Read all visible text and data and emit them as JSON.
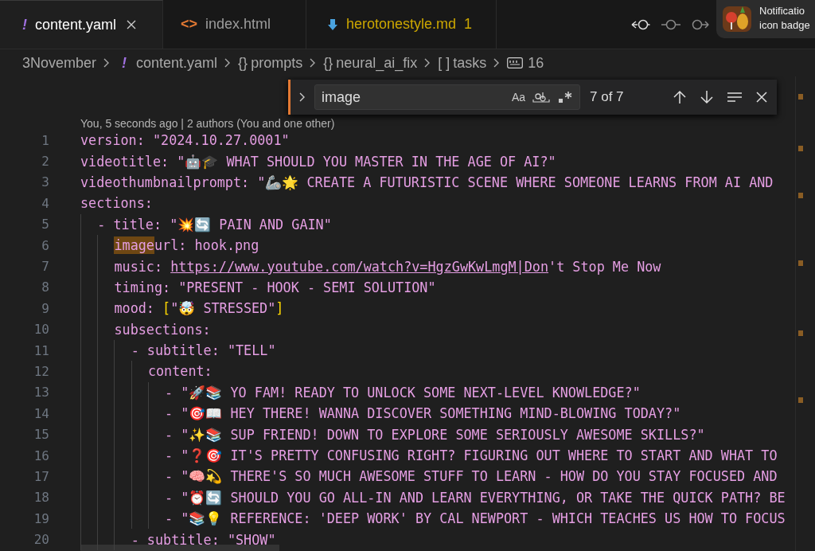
{
  "tabs": [
    {
      "label": "content.yaml",
      "kind": "text",
      "icon": "!",
      "selected": true,
      "closable": true
    },
    {
      "label": "index.html",
      "kind": "text",
      "icon": "<>",
      "selected": false
    },
    {
      "label": "herotonestyle.md",
      "kind": "download",
      "selected": false,
      "warning": true,
      "badge": "1"
    }
  ],
  "notification": {
    "lines": [
      "Notificatio",
      "icon badge"
    ]
  },
  "breadcrumbs": [
    {
      "label": "3November"
    },
    {
      "icon": "!",
      "label": "content.yaml"
    },
    {
      "icon": "{}",
      "label": "prompts"
    },
    {
      "icon": "{}",
      "label": "neural_ai_fix"
    },
    {
      "icon": "[ ]",
      "label": "tasks"
    },
    {
      "kind": "abc",
      "label": "16"
    }
  ],
  "find": {
    "value": "image",
    "result": "7 of 7",
    "options": [
      "Aa"
    ]
  },
  "blame": "You, 5 seconds ago | 2 authors (You and one other)",
  "lines": [
    {
      "number": "1",
      "text": "version: \"2024.10.27.0001\""
    },
    {
      "number": "2",
      "text": "videotitle: \"🤖🎓 WHAT SHOULD YOU MASTER IN THE AGE OF AI?\""
    },
    {
      "number": "3",
      "text": "videothumbnailprompt: \"🦾🌟 CREATE A FUTURISTIC SCENE WHERE SOMEONE LEARNS FROM AI AND"
    },
    {
      "number": "4",
      "text": "sections:"
    },
    {
      "number": "5",
      "text": "  - title: \"💥🔄 PAIN AND GAIN\""
    },
    {
      "number": "6",
      "segments": [
        {
          "kind": "match",
          "text": "    image"
        },
        {
          "kind": "plain",
          "text": "url: hook.png"
        }
      ]
    },
    {
      "number": "7",
      "segments": [
        {
          "kind": "plain",
          "text": "    music: "
        },
        {
          "kind": "link",
          "text": "https://www.youtube.com/watch?v=HgzGwKwLmgM|Don"
        },
        {
          "kind": "plain",
          "text": "'t Stop Me Now"
        }
      ]
    },
    {
      "number": "8",
      "text": "    timing: \"PRESENT - HOOK - SEMI SOLUTION\""
    },
    {
      "number": "9",
      "segments": [
        {
          "kind": "plain",
          "text": "    mood: "
        },
        {
          "kind": "bracket",
          "text": "["
        },
        {
          "kind": "plain",
          "text": "\"🤯 STRESSED\""
        },
        {
          "kind": "bracket",
          "text": "]"
        }
      ]
    },
    {
      "number": "10",
      "text": "    subsections:"
    },
    {
      "number": "11",
      "text": "      - subtitle: \"TELL\""
    },
    {
      "number": "12",
      "text": "        content:"
    },
    {
      "number": "13",
      "text": "          - \"🚀📚 YO FAM! READY TO UNLOCK SOME NEXT-LEVEL KNOWLEDGE?\""
    },
    {
      "number": "14",
      "text": "          - \"🎯📖 HEY THERE! WANNA DISCOVER SOMETHING MIND-BLOWING TODAY?\""
    },
    {
      "number": "15",
      "text": "          - \"✨📚 SUP FRIEND! DOWN TO EXPLORE SOME SERIOUSLY AWESOME SKILLS?\""
    },
    {
      "number": "16",
      "text": "          - \"❓🎯 IT'S PRETTY CONFUSING RIGHT? FIGURING OUT WHERE TO START AND WHAT TO"
    },
    {
      "number": "17",
      "text": "          - \"🧠💫 THERE'S SO MUCH AWESOME STUFF TO LEARN - HOW DO YOU STAY FOCUSED AND"
    },
    {
      "number": "18",
      "text": "          - \"⏰🔄 SHOULD YOU GO ALL-IN AND LEARN EVERYTHING, OR TAKE THE QUICK PATH? BE"
    },
    {
      "number": "19",
      "text": "          - \"📚💡 REFERENCE: 'DEEP WORK' BY CAL NEWPORT - WHICH TEACHES US HOW TO FOCUS"
    },
    {
      "number": "20",
      "text": "      - subtitle: \"SHOW\""
    }
  ]
}
